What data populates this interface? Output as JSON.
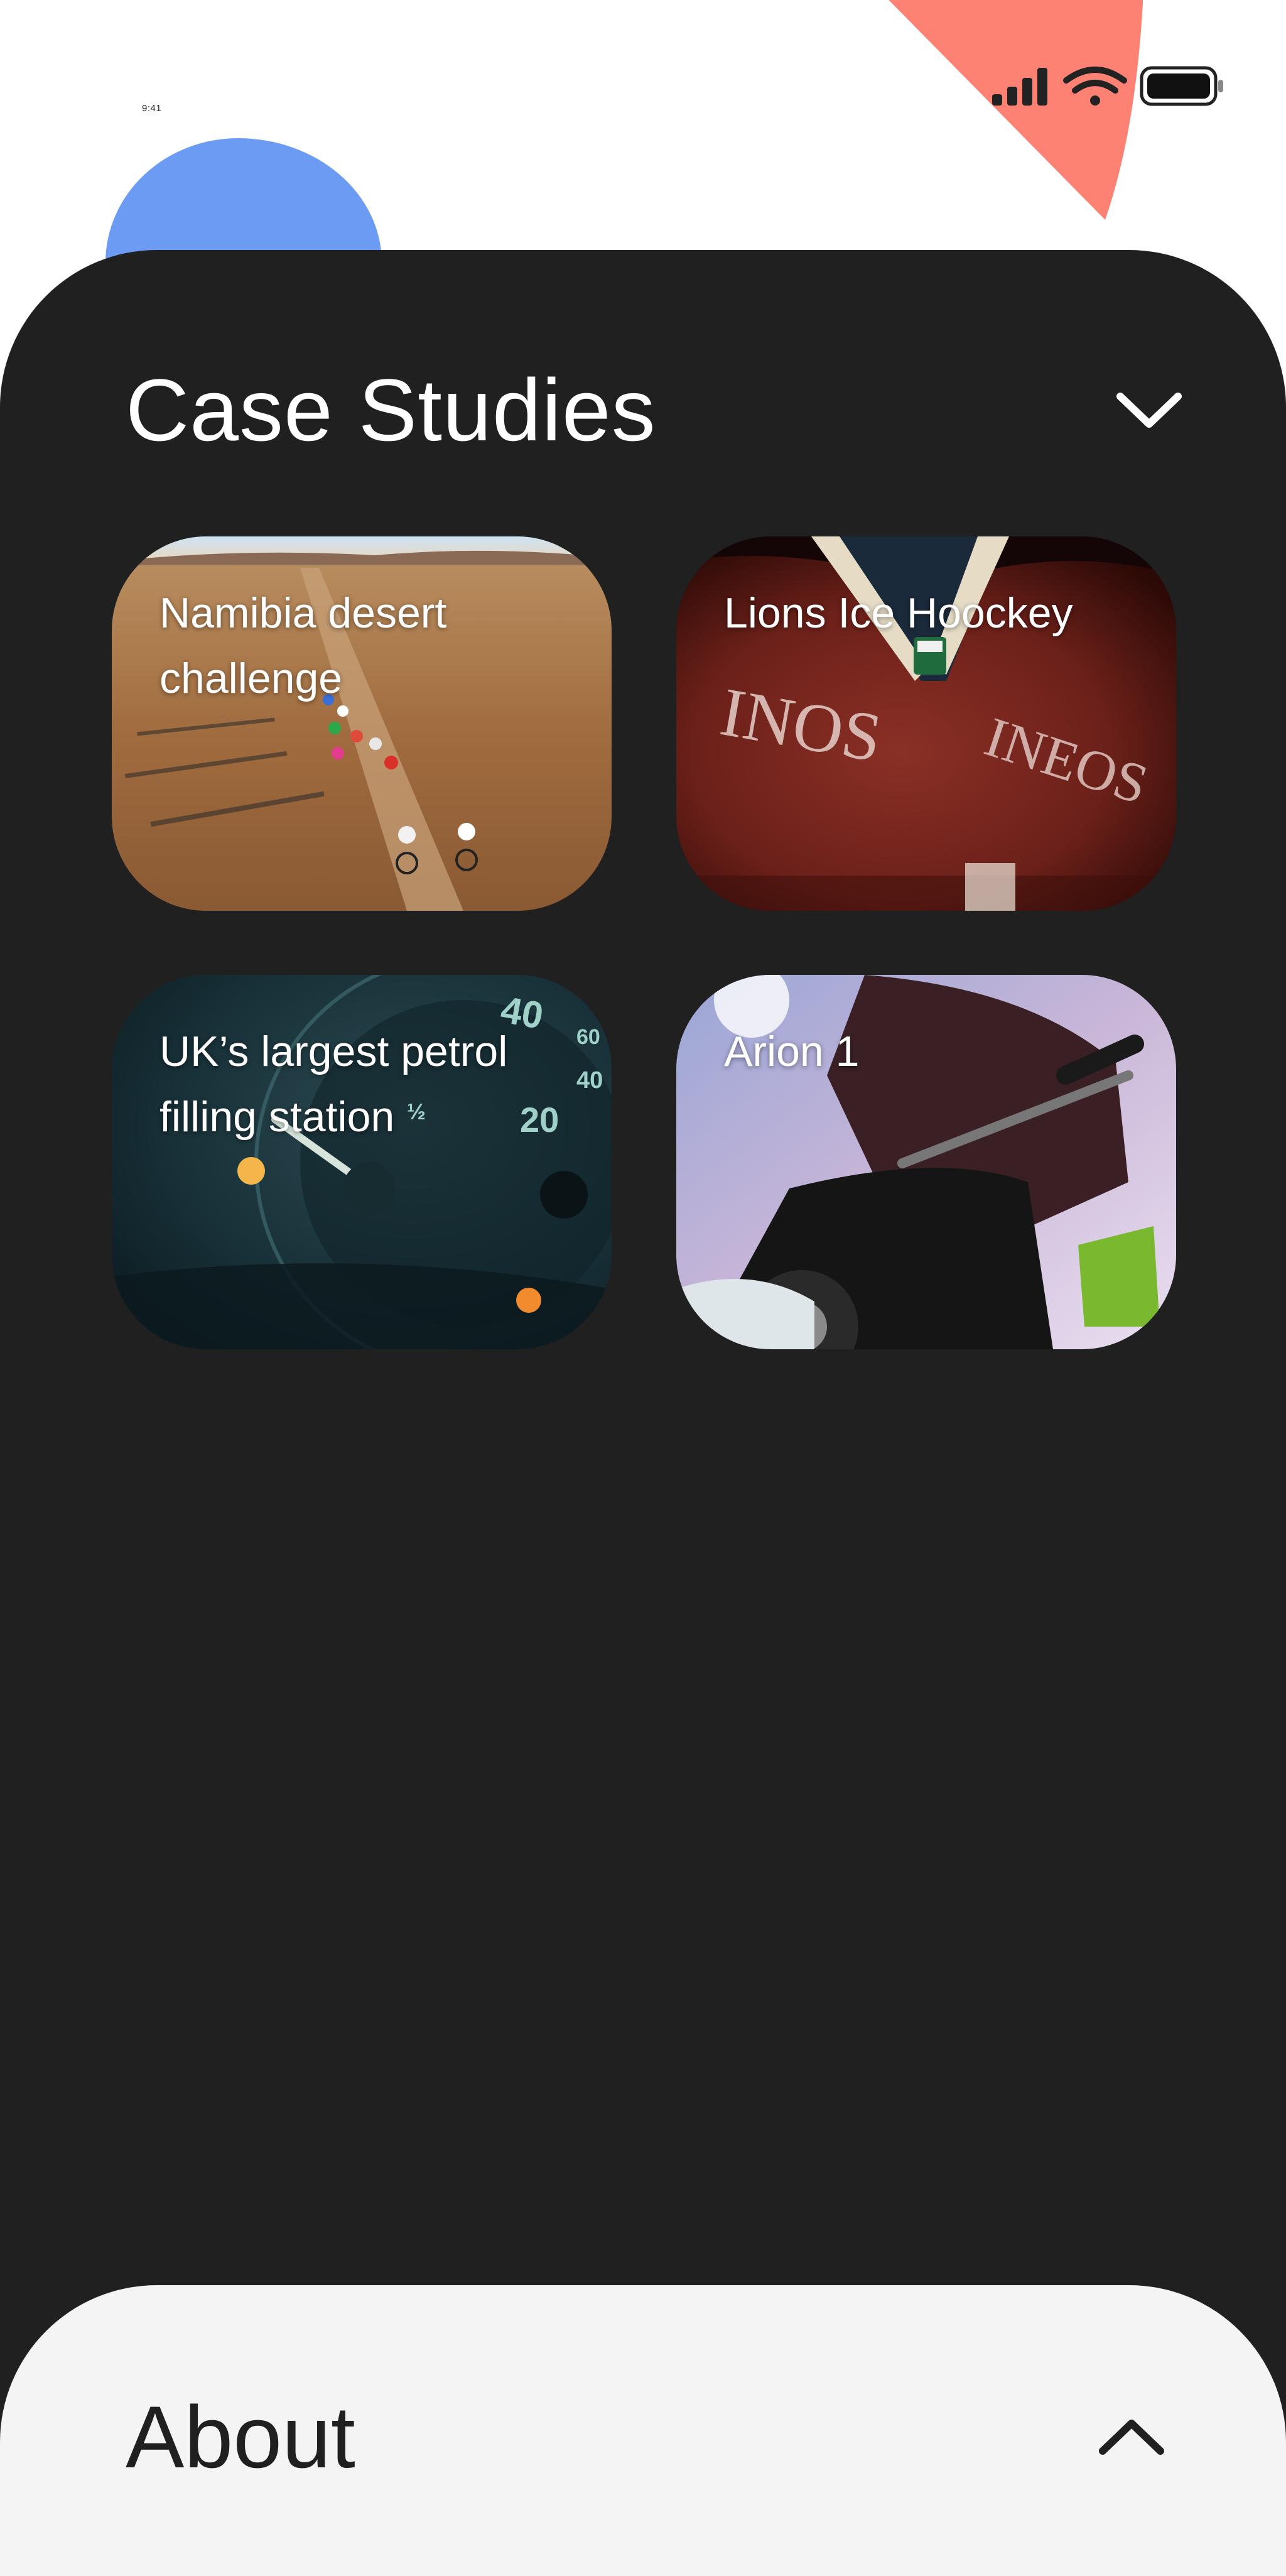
{
  "status_bar": {
    "time": "9:41",
    "icons": [
      "cellular-signal-icon",
      "wifi-icon",
      "battery-icon"
    ]
  },
  "decor": {
    "blue_blob_color": "#6c9bf3",
    "coral_blob_color": "#fe8273"
  },
  "case_studies": {
    "title": "Case Studies",
    "toggle_icon": "chevron-down-icon",
    "background_color": "#202020",
    "cards": [
      {
        "label": "Namibia desert challenge",
        "image": "desert-cyclists-image"
      },
      {
        "label": "Lions Ice Hoockey",
        "image": "hockey-jersey-image"
      },
      {
        "label": "UK’s largest petrol filling station",
        "image": "fuel-gauge-image"
      },
      {
        "label": "Arion 1",
        "image": "motorbike-rider-image"
      }
    ]
  },
  "about": {
    "title": "About",
    "toggle_icon": "chevron-up-icon",
    "background_color": "#f4f4f4"
  }
}
